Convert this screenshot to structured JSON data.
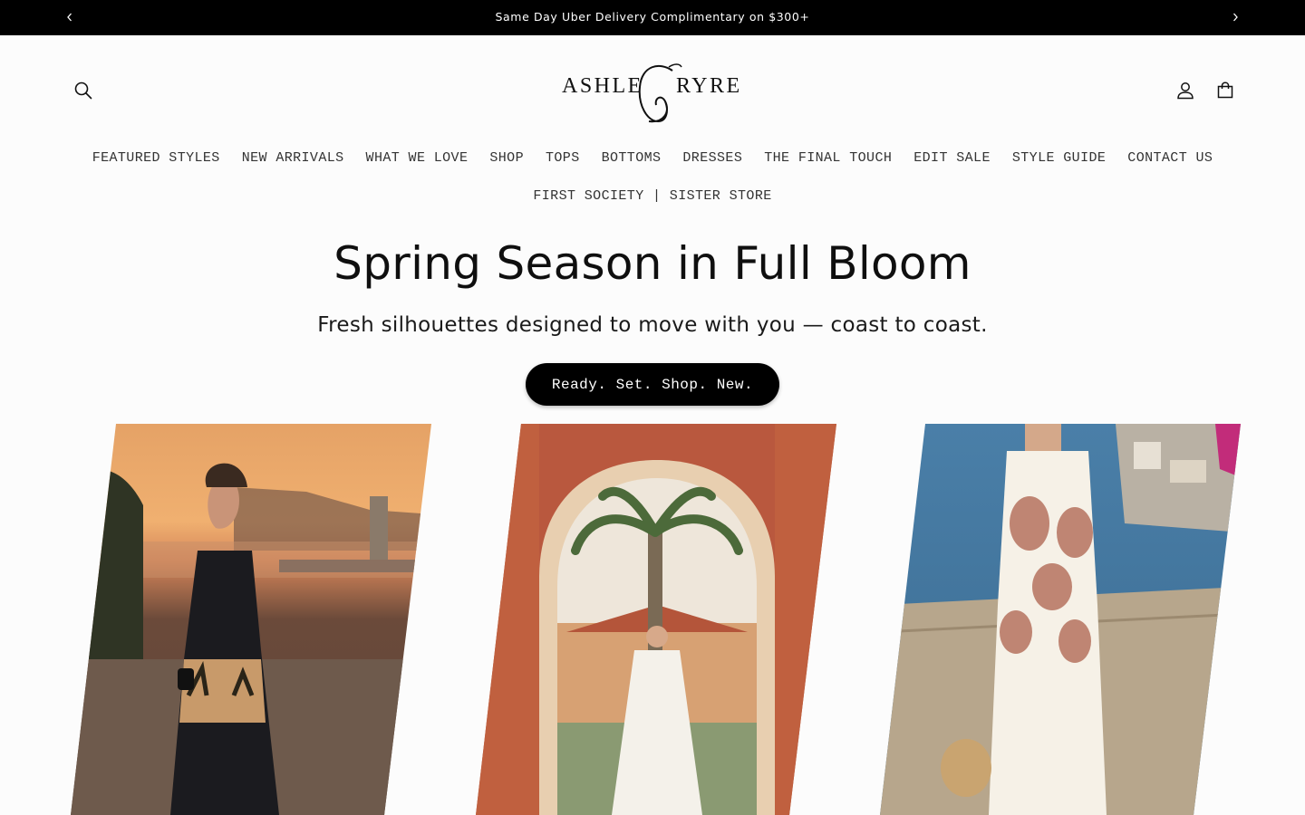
{
  "announcement": {
    "text": "Same Day Uber Delivery Complimentary on $300+",
    "prev_icon": "chevron-left-icon",
    "next_icon": "chevron-right-icon"
  },
  "header": {
    "logo_text": "ASHLEYGRYRE",
    "search_icon": "search-icon",
    "account_icon": "account-icon",
    "cart_icon": "cart-icon"
  },
  "nav": {
    "row1": [
      "FEATURED STYLES",
      "NEW ARRIVALS",
      "WHAT WE LOVE",
      "SHOP",
      "TOPS",
      "BOTTOMS",
      "DRESSES",
      "THE FINAL TOUCH",
      "EDIT SALE",
      "STYLE GUIDE",
      "CONTACT US"
    ],
    "row2": [
      "FIRST SOCIETY | SISTER STORE"
    ]
  },
  "hero": {
    "title": "Spring Season in Full Bloom",
    "subtitle": "Fresh silhouettes designed to move with you — coast to coast.",
    "cta": "Ready. Set. Shop. New."
  },
  "colors": {
    "announcement_bg": "#000000",
    "page_bg": "#fcfcfc",
    "button_bg": "#000000"
  }
}
